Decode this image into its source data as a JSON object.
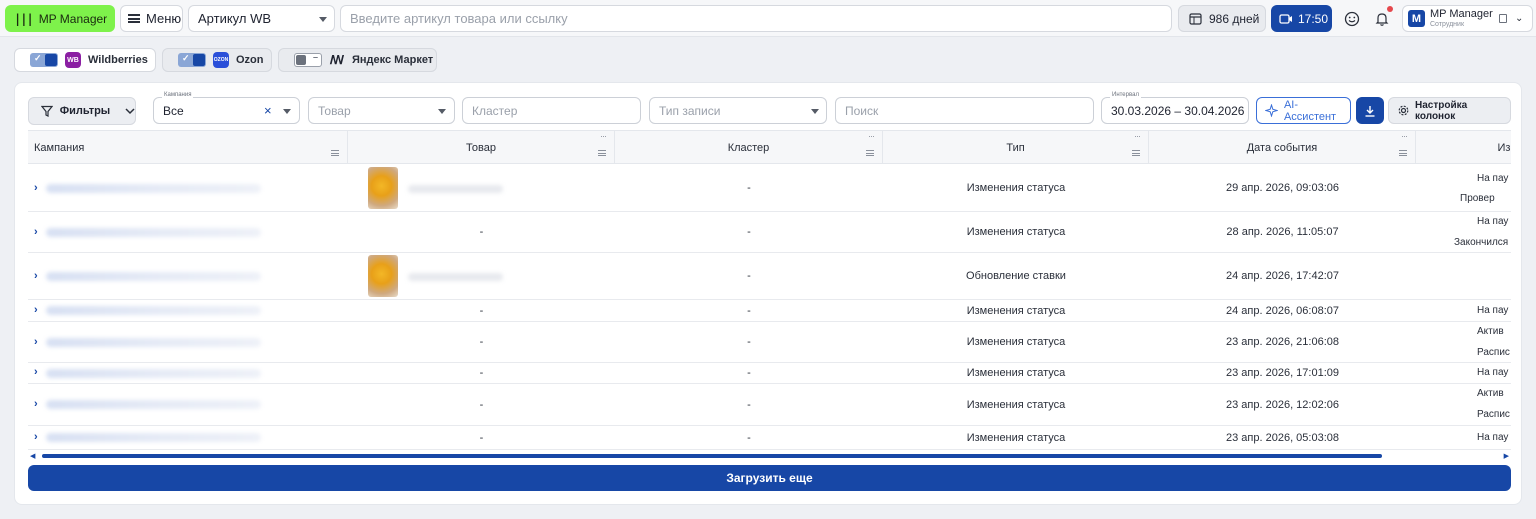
{
  "topbar": {
    "logo_label": "MP Manager",
    "menu_label": "Меню",
    "article_select": "Артикул WB",
    "search_placeholder": "Введите артикул товара или ссылку",
    "days_label": "986 дней",
    "time_label": "17:50",
    "user_name": "MP Manager",
    "user_role": "Сотрудник",
    "avatar_letter": "M"
  },
  "marketplaces": [
    {
      "name": "Wildberries",
      "enabled": true,
      "logo": "WB",
      "color": "#8b1fa3"
    },
    {
      "name": "Ozon",
      "enabled": true,
      "logo": "OZON",
      "color": "#2a4fd9"
    },
    {
      "name": "Яндекс Маркет",
      "enabled": false,
      "logo": "YM",
      "color": "#ffcc00"
    }
  ],
  "toolbar": {
    "filters_label": "Фильтры",
    "campaign_label": "Кампания",
    "campaign_value": "Все",
    "product_placeholder": "Товар",
    "cluster_placeholder": "Кластер",
    "record_type_placeholder": "Тип записи",
    "search_placeholder": "Поиск",
    "interval_label": "Интервал",
    "interval_value": "30.03.2026 – 30.04.2026",
    "ai_label": "AI-Ассистент",
    "columns_label": "Настройка колонок"
  },
  "table": {
    "columns": [
      "Кампания",
      "Товар",
      "Кластер",
      "Тип",
      "Дата события",
      "Изм"
    ],
    "rows": [
      {
        "product": "",
        "cluster": "-",
        "type": "Изменения статуса",
        "date": "29 апр. 2026, 09:03:06",
        "change": [
          "На пау",
          "Провер"
        ]
      },
      {
        "product": "-",
        "cluster": "-",
        "type": "Изменения статуса",
        "date": "28 апр. 2026, 11:05:07",
        "change": [
          "На пау",
          "Закончился"
        ]
      },
      {
        "product": "",
        "cluster": "-",
        "type": "Обновление ставки",
        "date": "24 апр. 2026, 17:42:07",
        "change": []
      },
      {
        "product": "-",
        "cluster": "-",
        "type": "Изменения статуса",
        "date": "24 апр. 2026, 06:08:07",
        "change": [
          "На пау"
        ]
      },
      {
        "product": "-",
        "cluster": "-",
        "type": "Изменения статуса",
        "date": "23 апр. 2026, 21:06:08",
        "change": [
          "Актив",
          "Распис"
        ]
      },
      {
        "product": "-",
        "cluster": "-",
        "type": "Изменения статуса",
        "date": "23 апр. 2026, 17:01:09",
        "change": [
          "На пау"
        ]
      },
      {
        "product": "-",
        "cluster": "-",
        "type": "Изменения статуса",
        "date": "23 апр. 2026, 12:02:06",
        "change": [
          "Актив",
          "Распис"
        ]
      },
      {
        "product": "-",
        "cluster": "-",
        "type": "Изменения статуса",
        "date": "23 апр. 2026, 05:03:08",
        "change": [
          "На пау"
        ]
      }
    ]
  },
  "load_more_label": "Загрузить еще",
  "colors": {
    "accent": "#1747a6",
    "logo_green": "#7ef24b"
  }
}
